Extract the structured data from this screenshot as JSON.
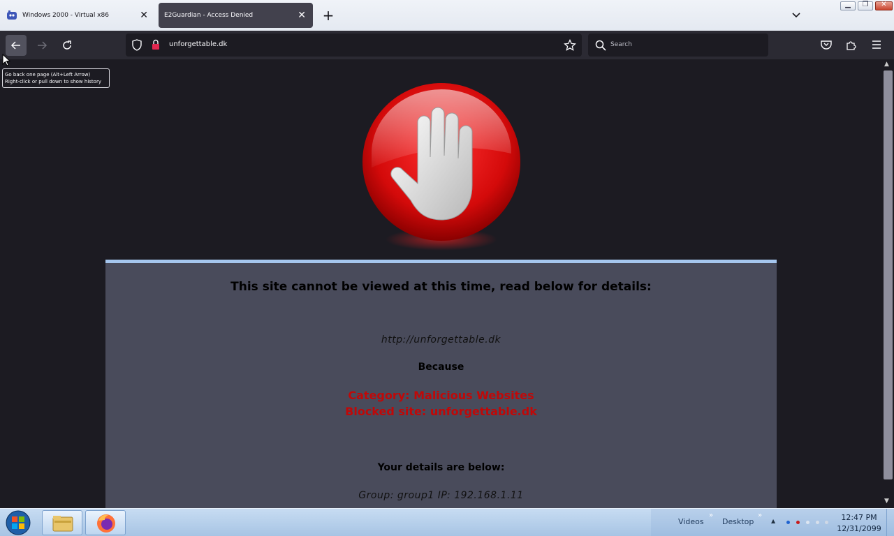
{
  "tabs": [
    {
      "title": "Windows 2000 - Virtual x86",
      "active": false
    },
    {
      "title": "E2Guardian - Access Denied",
      "active": true
    }
  ],
  "navbar": {
    "url": "unforgettable.dk",
    "search_placeholder": "Search"
  },
  "tooltip": {
    "line1": "Go back one page (Alt+Left Arrow)",
    "line2": "Right-click or pull down to show history"
  },
  "page": {
    "heading": "This site cannot be viewed at this time, read below for details:",
    "url": "http://unforgettable.dk",
    "because": "Because",
    "category": "Category: Malicious Websites",
    "blocked": "Blocked site: unforgettable.dk",
    "details_heading": "Your details are below:",
    "group_ip": "Group: group1   IP: 192.168.1.11"
  },
  "taskbar": {
    "toolbar_videos": "Videos",
    "toolbar_desktop": "Desktop",
    "time": "12:47 PM",
    "date": "12/31/2099"
  },
  "colors": {
    "accent_red": "#c00808",
    "panel_bg": "#494b5b",
    "panel_border": "#a5c6ee",
    "page_bg": "#1c1b22"
  }
}
